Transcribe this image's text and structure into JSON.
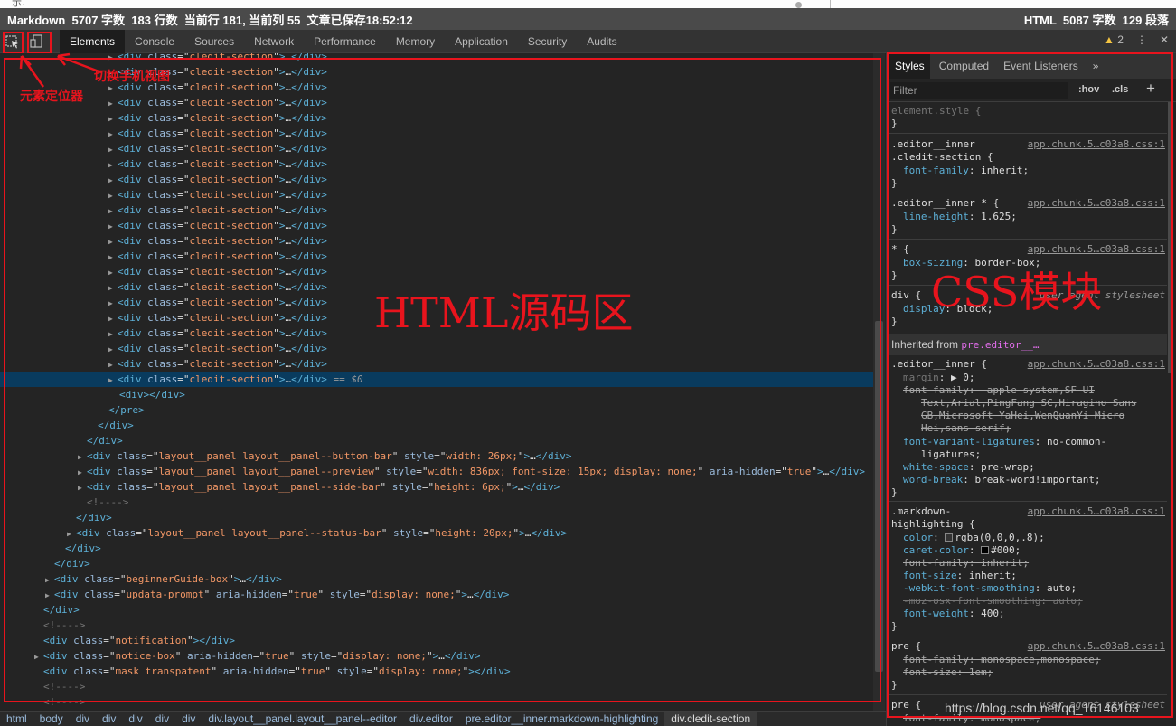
{
  "statusbar": {
    "top_prefix": "示.",
    "left": "Markdown  5707 字数  183 行数  当前行 181, 当前列 55  文章已保存18:52:12",
    "right": "HTML  5087 字数  129 段落"
  },
  "toolbar": {
    "tabs": [
      "Elements",
      "Console",
      "Sources",
      "Network",
      "Performance",
      "Memory",
      "Application",
      "Security",
      "Audits"
    ],
    "active_tab": "Elements",
    "warnings_count": "2",
    "icons": [
      "inspect-element-icon",
      "device-toolbar-icon",
      "warning-icon",
      "kebab-menu-icon",
      "close-icon"
    ]
  },
  "dom": {
    "repeated": {
      "tag": "div",
      "attr": "class",
      "value": "cledit-section",
      "ellipsis": "…"
    },
    "selected_suffix": " == $0",
    "lines_after": [
      {
        "indent": 132,
        "arrow": false,
        "cls": "tag",
        "text": "<div></div>"
      },
      {
        "indent": 120,
        "arrow": false,
        "cls": "tag",
        "text": "</pre>"
      },
      {
        "indent": 108,
        "arrow": false,
        "cls": "tag",
        "text": "</div>"
      },
      {
        "indent": 96,
        "arrow": false,
        "cls": "tag",
        "text": "</div>"
      },
      {
        "indent": 96,
        "arrow": true,
        "tag": "div",
        "attrs": [
          [
            "class",
            "layout__panel layout__panel--button-bar"
          ],
          [
            "style",
            "width: 26px;"
          ]
        ],
        "close": "…</div>"
      },
      {
        "indent": 96,
        "arrow": true,
        "tag": "div",
        "attrs": [
          [
            "class",
            "layout__panel layout__panel--preview"
          ],
          [
            "style",
            "width: 836px; font-size: 15px; display: none;"
          ],
          [
            "aria-hidden",
            "true"
          ]
        ],
        "close": "…</div>"
      },
      {
        "indent": 96,
        "arrow": true,
        "tag": "div",
        "attrs": [
          [
            "class",
            "layout__panel layout__panel--side-bar"
          ],
          [
            "style",
            "height: 6px;"
          ]
        ],
        "close": "…</div>"
      },
      {
        "indent": 96,
        "arrow": false,
        "cls": "cm",
        "text": "<!---->"
      },
      {
        "indent": 84,
        "arrow": false,
        "cls": "tag",
        "text": "</div>"
      },
      {
        "indent": 84,
        "arrow": true,
        "tag": "div",
        "attrs": [
          [
            "class",
            "layout__panel layout__panel--status-bar"
          ],
          [
            "style",
            "height: 20px;"
          ]
        ],
        "close": "…</div>"
      },
      {
        "indent": 72,
        "arrow": false,
        "cls": "tag",
        "text": "</div>"
      },
      {
        "indent": 60,
        "arrow": false,
        "cls": "tag",
        "text": "</div>"
      },
      {
        "indent": 60,
        "arrow": true,
        "tag": "div",
        "attrs": [
          [
            "class",
            "beginnerGuide-box"
          ]
        ],
        "close": "…</div>"
      },
      {
        "indent": 60,
        "arrow": true,
        "tag": "div",
        "attrs": [
          [
            "class",
            "updata-prompt"
          ],
          [
            "aria-hidden",
            "true"
          ],
          [
            "style",
            "display: none;"
          ]
        ],
        "close": "…</div>"
      },
      {
        "indent": 48,
        "arrow": false,
        "cls": "tag",
        "text": "</div>"
      },
      {
        "indent": 48,
        "arrow": false,
        "cls": "cm",
        "text": "<!---->"
      },
      {
        "indent": 48,
        "arrow": false,
        "tag": "div",
        "attrs": [
          [
            "class",
            "notification"
          ]
        ],
        "close": "</div>"
      },
      {
        "indent": 48,
        "arrow": true,
        "tag": "div",
        "attrs": [
          [
            "class",
            "notice-box"
          ],
          [
            "aria-hidden",
            "true"
          ],
          [
            "style",
            "display: none;"
          ]
        ],
        "close": "…</div>"
      },
      {
        "indent": 48,
        "arrow": false,
        "tag": "div",
        "attrs": [
          [
            "class",
            "mask transpatent"
          ],
          [
            "aria-hidden",
            "true"
          ],
          [
            "style",
            "display: none;"
          ]
        ],
        "close": "</div>"
      },
      {
        "indent": 48,
        "arrow": false,
        "cls": "cm",
        "text": "<!---->"
      },
      {
        "indent": 48,
        "arrow": false,
        "cls": "cm",
        "text": "<!---->"
      }
    ]
  },
  "breadcrumb": [
    "html",
    "body",
    "div",
    "div",
    "div",
    "div",
    "div",
    "div.layout__panel.layout__panel--editor",
    "div.editor",
    "pre.editor__inner.markdown-highlighting",
    "div.cledit-section"
  ],
  "styles": {
    "tabs": [
      "Styles",
      "Computed",
      "Event Listeners",
      "»"
    ],
    "active_tab": "Styles",
    "filter_placeholder": "Filter",
    "hov": ":hov",
    "cls": ".cls",
    "plus": "+",
    "src": "app.chunk.5…c03a8.css:1",
    "ua": "user agent stylesheet",
    "inherited_label": "Inherited from ",
    "inherited_selector": "pre.editor__…",
    "texts": {
      "element_style": "element.style {",
      "close": "}",
      "sel_editor_inner": ".editor__inner",
      "sel_cledit": ".cledit-section {",
      "font_family": "font-family",
      "inherit": "inherit;",
      "sel_inner_star": ".editor__inner * {",
      "line_height": "line-height",
      "lh_val": "1.625;",
      "sel_star": "* {",
      "box_sizing": "box-sizing",
      "border_box": "border-box;",
      "sel_div": "div {",
      "display": "display",
      "block": "block;",
      "sel_inner2": ".editor__inner {",
      "margin": "margin",
      "margin_val": "0;",
      "ff_val1": "-apple-system,SF UI",
      "ff_val2": "Text,Arial,PingFang SC,Hiragino Sans",
      "ff_val3": "GB,Microsoft YaHei,WenQuanYi Micro",
      "ff_val4": "Hei,sans-serif;",
      "fvl": "font-variant-ligatures",
      "fvl_val1": "no-common-",
      "fvl_val2": "ligatures;",
      "white_space": "white-space",
      "ws_val": "pre-wrap;",
      "word_break": "word-break",
      "wb_val": "break-word!important;",
      "sel_md1": ".markdown-",
      "sel_md2": "highlighting {",
      "color": "color",
      "color_val": "rgba(0,0,0,.8);",
      "caret_color": "caret-color",
      "caret_val": "#000;",
      "font_size": "font-size",
      "wfs": "-webkit-font-smoothing",
      "wfs_val": "auto;",
      "moz": "-moz-osx-font-smoothing: auto;",
      "font_weight": "font-weight",
      "fw_val": "400;",
      "sel_pre": "pre {",
      "ff_mono": "monospace,monospace;",
      "fs_1em": "1em;",
      "ff_mono2": "monospace;"
    }
  },
  "annotations": {
    "locator": "元素定位器",
    "mobile": "切换手机视图",
    "html_area": "HTML源码区",
    "css_module": "CSS模块"
  },
  "watermark": "https://blog.csdn.net/qq_16146103",
  "colors": {
    "annotation_red": "#e8141d",
    "selection_bg": "#093b5e",
    "tag_blue": "#5db0d7",
    "attr_value": "#f29766"
  }
}
